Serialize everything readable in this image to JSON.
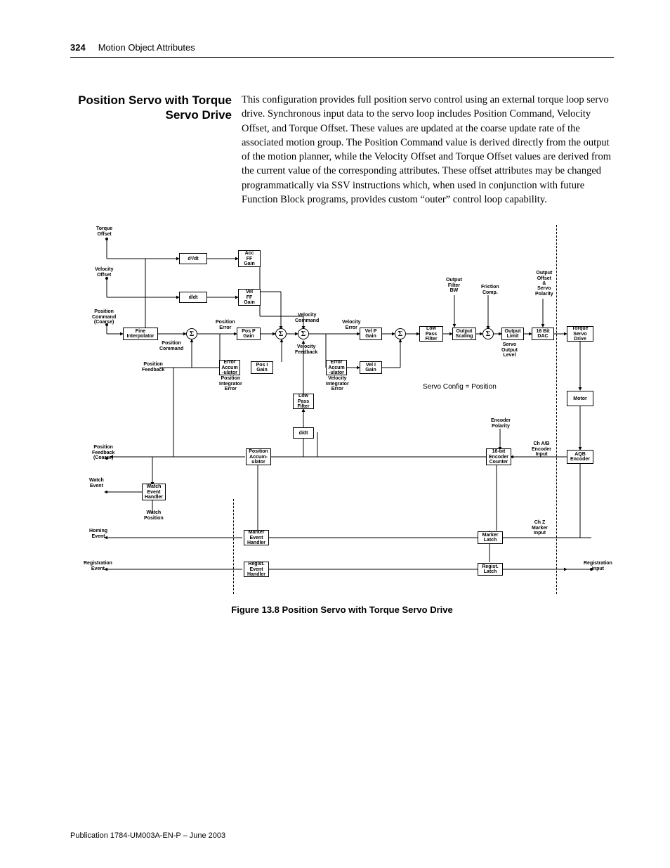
{
  "header": {
    "page_number": "324",
    "chapter_title": "Motion Object Attributes"
  },
  "section": {
    "title": "Position Servo with Torque Servo Drive",
    "body": "This configuration provides full position servo control using an external torque loop servo drive. Synchronous input data to the servo loop includes Position Command, Velocity Offset, and Torque Offset. These values are updated at the coarse update rate of the associated motion group. The Position Command value is derived directly from the output of the motion planner, while the Velocity Offset and Torque Offset values are derived from the current value of the corresponding attributes. These offset attributes may be changed programmatically via SSV instructions which, when used in conjunction with future Function Block programs, provides custom “outer” control loop capability."
  },
  "figure": {
    "caption": "Figure 13.8 Position Servo with Torque Servo Drive",
    "servo_config_text": "Servo Config = Position",
    "labels": {
      "torque_offset": "Torque\nOffset",
      "velocity_offset": "Velocity\nOffset",
      "position_command_coarse": "Position\nCommand\n(Coarse)",
      "position_feedback_coarse": "Position\nFeedback\n(Coarse)",
      "watch_event": "Watch\nEvent",
      "homing_event": "Homing\nEvent",
      "registration_event": "Registration\nEvent",
      "registration_input": "Registration\nInput",
      "d2dt": "d²/dt",
      "ddt": "d/dt",
      "acc_ff_gain": "Acc\nFF\nGain",
      "vel_ff_gain": "Vel\nFF\nGain",
      "fine_interpolator": "Fine\nInterpolator",
      "position_command": "Position\nCommand",
      "position_error": "Position\nError",
      "pos_p_gain": "Pos P\nGain",
      "position_feedback": "Position\nFeedback",
      "error_accum": "Error\nAccum\n-ulator",
      "pos_i_gain": "Pos I\nGain",
      "position_integrator_error": "Position\nIntegrator\nError",
      "velocity_command": "Velocity\nCommand",
      "velocity_error": "Velocity\nError",
      "vel_p_gain": "Vel P\nGain",
      "velocity_feedback": "Velocity\nFeedback",
      "vel_i_gain": "Vel I\nGain",
      "velocity_integrator_error": "Velocity\nIntegrator\nError",
      "low_pass_filter": "Low\nPass\nFilter",
      "output_filter_bw": "Output\nFilter\nBW",
      "output_scaling": "Output\nScaling",
      "friction_comp": "Friction\nComp.",
      "output_limit": "Output\nLimit",
      "output_offset_polarity": "Output\nOffset\n&\nServo\nPolarity",
      "servo_output_level": "Servo\nOutput\nLevel",
      "sixteen_bit_dac": "16 Bit\nDAC",
      "torque_servo_drive": "Torque\nServo\nDrive",
      "motor": "Motor",
      "encoder_polarity": "Encoder\nPolarity",
      "ch_ab_encoder_input": "Ch A/B\nEncoder\nInput",
      "sixteen_bit_encoder_counter": "16-bit\nEncoder\nCounter",
      "aqb_encoder": "AQB\nEncoder",
      "position_accumulator": "Position\nAccum-\nulator",
      "watch_event_handler": "Watch\nEvent\nHandler",
      "watch_position": "Watch\nPosition",
      "ch_z_marker_input": "Ch Z\nMarker\nInput",
      "marker_event_handler": "Marker\nEvent\nHandler",
      "marker_latch": "Marker\nLatch",
      "regist_event_handler": "Regist.\nEvent\nHandler",
      "regist_latch": "Regist.\nLatch",
      "sigma": "Σ"
    }
  },
  "footer": {
    "publication": "Publication 1784-UM003A-EN-P – June 2003"
  }
}
